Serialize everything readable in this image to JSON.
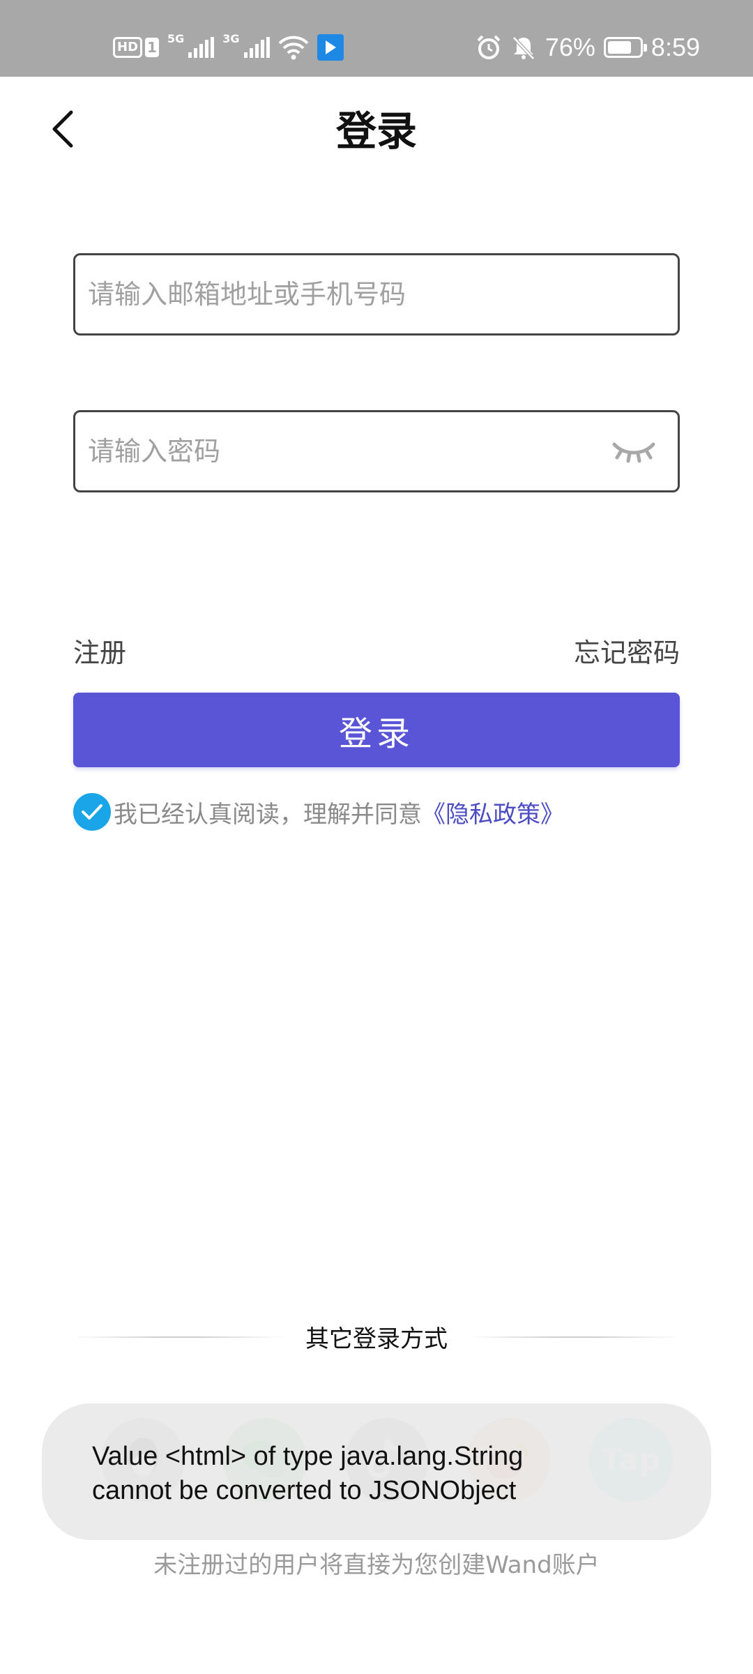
{
  "status_bar": {
    "hd_label": "HD",
    "sim_label": "1",
    "network_1": "5G",
    "network_2": "3G",
    "battery": "76%",
    "time": "8:59",
    "battery_level": 0.76
  },
  "header": {
    "title": "登录"
  },
  "form": {
    "account_placeholder": "请输入邮箱地址或手机号码",
    "password_placeholder": "请输入密码",
    "register_label": "注册",
    "forgot_label": "忘记密码",
    "login_label": "登录"
  },
  "agreement": {
    "text": "我已经认真阅读，理解并同意",
    "link": "《隐私政策》",
    "checked": true
  },
  "other_login": {
    "title": "其它登录方式",
    "providers": [
      {
        "name": "qq-icon",
        "glyph": ""
      },
      {
        "name": "wechat-icon",
        "glyph": ""
      },
      {
        "name": "tiktok-icon",
        "glyph": ""
      },
      {
        "name": "weibo-icon",
        "glyph": ""
      },
      {
        "name": "taptap-icon",
        "glyph": "Tap"
      }
    ]
  },
  "toast": {
    "line1": "Value <html> of type java.lang.String",
    "line2": "cannot be converted to JSONObject"
  },
  "footer": {
    "note": "未注册过的用户将直接为您创建Wand账户"
  },
  "colors": {
    "accent": "#5a55d6",
    "check": "#1aa5e8",
    "link": "#4c4cc4"
  }
}
